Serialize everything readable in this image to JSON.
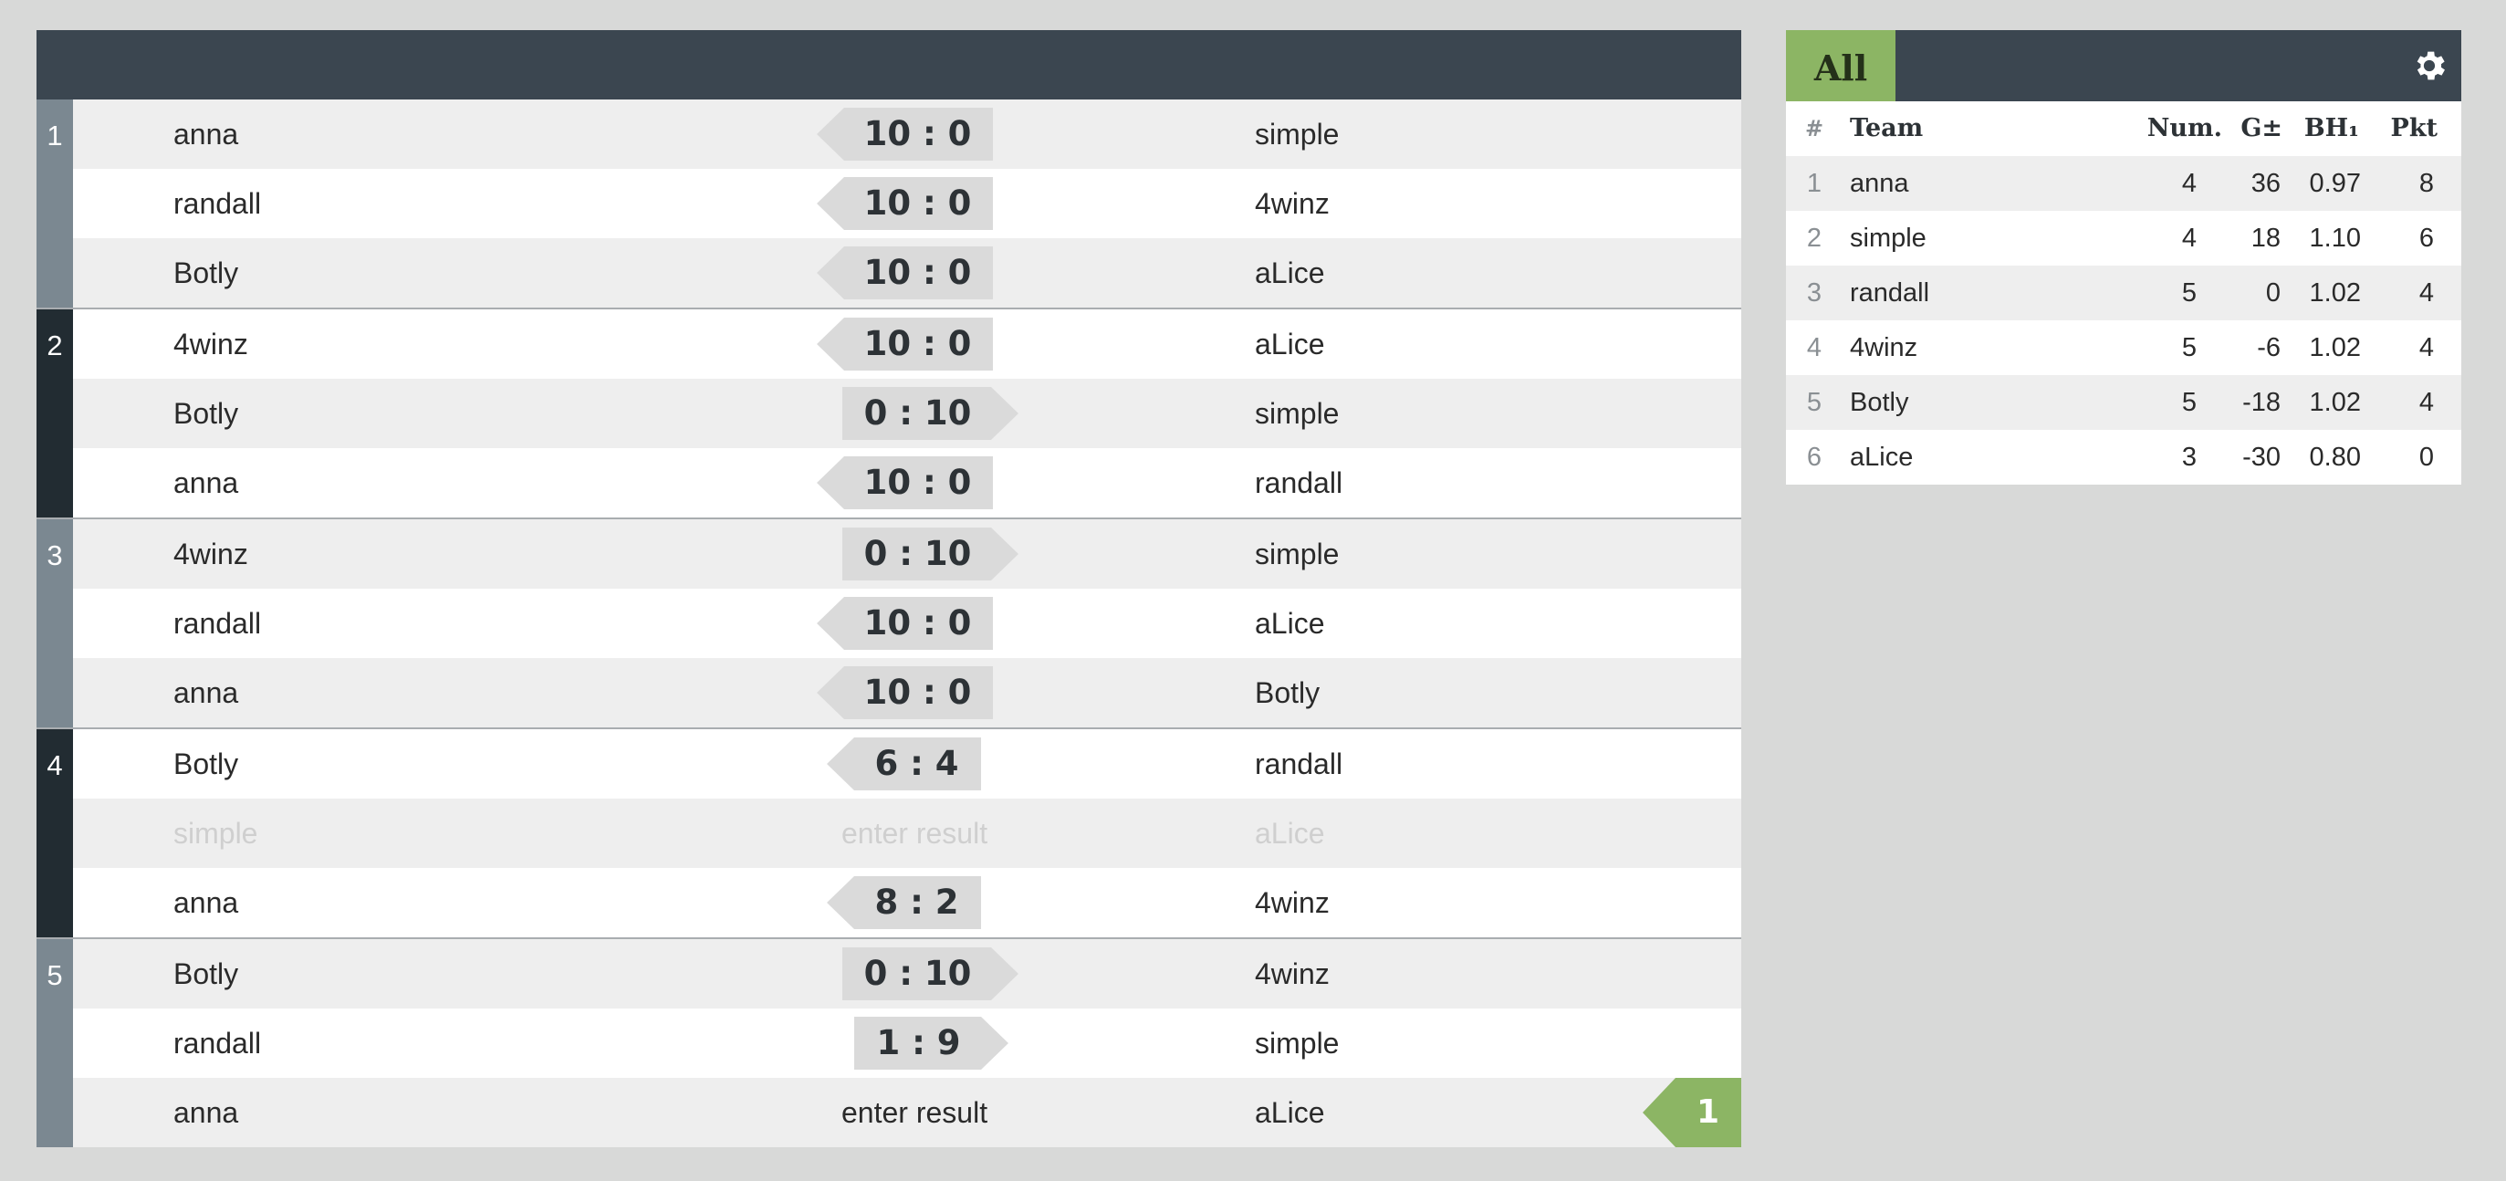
{
  "rounds": [
    {
      "number": "1",
      "matches": [
        {
          "team_a": "anna",
          "score": "10 : 0",
          "team_b": "simple"
        },
        {
          "team_a": "randall",
          "score": "10 : 0",
          "team_b": "4winz"
        },
        {
          "team_a": "Botly",
          "score": "10 : 0",
          "team_b": "aLice"
        }
      ]
    },
    {
      "number": "2",
      "matches": [
        {
          "team_a": "4winz",
          "score": "10 : 0",
          "team_b": "aLice"
        },
        {
          "team_a": "Botly",
          "score": "0 : 10",
          "team_b": "simple"
        },
        {
          "team_a": "anna",
          "score": "10 : 0",
          "team_b": "randall"
        }
      ]
    },
    {
      "number": "3",
      "matches": [
        {
          "team_a": "4winz",
          "score": "0 : 10",
          "team_b": "simple"
        },
        {
          "team_a": "randall",
          "score": "10 : 0",
          "team_b": "aLice"
        },
        {
          "team_a": "anna",
          "score": "10 : 0",
          "team_b": "Botly"
        }
      ]
    },
    {
      "number": "4",
      "matches": [
        {
          "team_a": "Botly",
          "score": "6 : 4",
          "team_b": "randall"
        },
        {
          "team_a": "simple",
          "entry": "enter result",
          "team_b": "aLice"
        },
        {
          "team_a": "anna",
          "score": "8 : 2",
          "team_b": "4winz"
        }
      ]
    },
    {
      "number": "5",
      "matches": [
        {
          "team_a": "Botly",
          "score": "0 : 10",
          "team_b": "4winz"
        },
        {
          "team_a": "randall",
          "score": "1 : 9",
          "team_b": "simple"
        },
        {
          "team_a": "anna",
          "entry": "enter result",
          "team_b": "aLice"
        }
      ]
    }
  ],
  "pending_badge": "1",
  "standings": {
    "tab_label": "All",
    "settings_icon": "gear-icon",
    "headers": {
      "rank": "#",
      "team": "Team",
      "num": "Num.",
      "goal": "G±",
      "bh": "BH₁",
      "pkt": "Pkt"
    },
    "rows": [
      {
        "rank": "1",
        "team": "anna",
        "num": "4",
        "goal": "36",
        "bh": "0.97",
        "pkt": "8"
      },
      {
        "rank": "2",
        "team": "simple",
        "num": "4",
        "goal": "18",
        "bh": "1.10",
        "pkt": "6"
      },
      {
        "rank": "3",
        "team": "randall",
        "num": "5",
        "goal": "0",
        "bh": "1.02",
        "pkt": "4"
      },
      {
        "rank": "4",
        "team": "4winz",
        "num": "5",
        "goal": "-6",
        "bh": "1.02",
        "pkt": "4"
      },
      {
        "rank": "5",
        "team": "Botly",
        "num": "5",
        "goal": "-18",
        "bh": "1.02",
        "pkt": "4"
      },
      {
        "rank": "6",
        "team": "aLice",
        "num": "3",
        "goal": "-30",
        "bh": "0.80",
        "pkt": "0"
      }
    ]
  },
  "colors": {
    "header": "#3b4650",
    "accent": "#8cb564",
    "round_odd": "#7b8891",
    "round_even": "#222c32"
  }
}
